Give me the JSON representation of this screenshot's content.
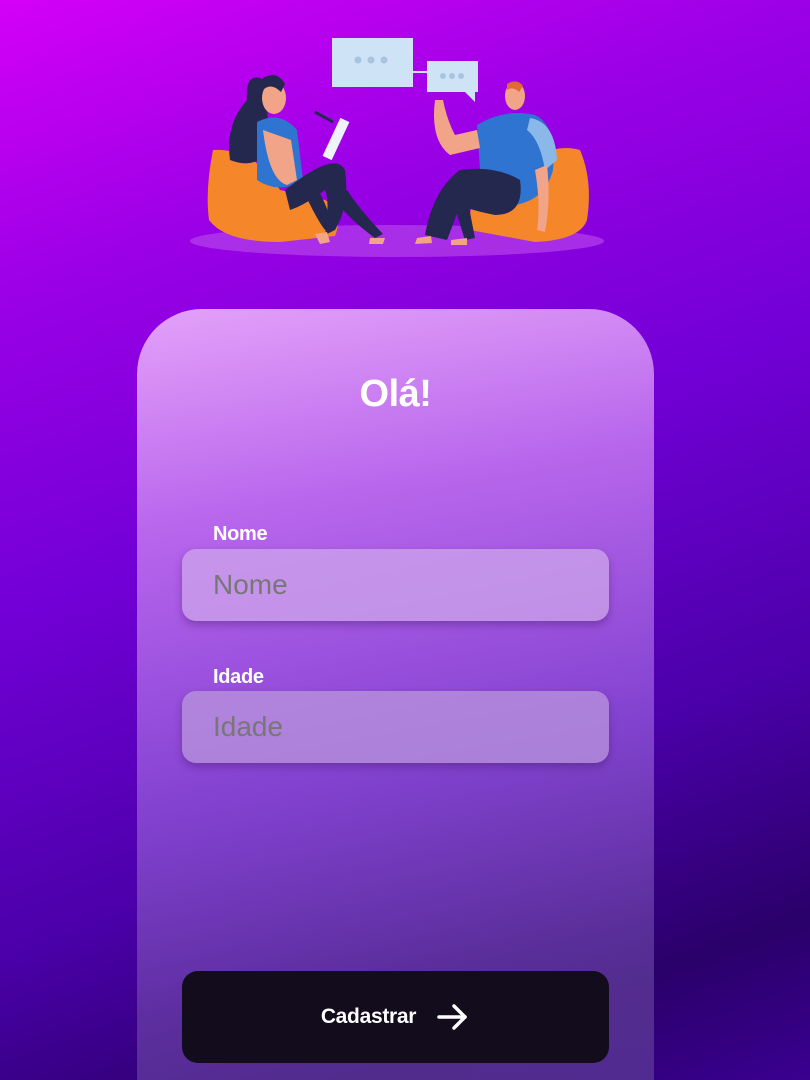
{
  "form": {
    "title": "Olá!",
    "name_label": "Nome",
    "name_placeholder": "Nome",
    "age_label": "Idade",
    "age_placeholder": "Idade",
    "submit_label": "Cadastrar",
    "submit_icon": "arrow-right-icon"
  },
  "illustration": {
    "name": "two-people-chatting-illustration",
    "colors": {
      "chair": "#f5862a",
      "shirt_blue": "#2f74d0",
      "bubble": "#cfe3f6",
      "skin": "#f2a488",
      "pants": "#1f2a5a"
    }
  }
}
